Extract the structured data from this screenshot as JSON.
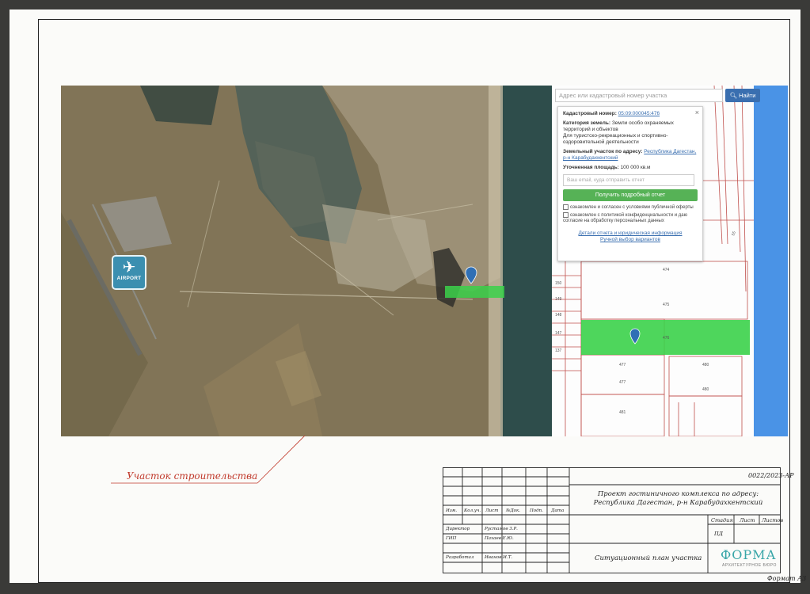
{
  "map": {
    "airport_label": "AIRPORT",
    "search_placeholder": "Адрес или кадастровый номер участка",
    "search_button": "Найти"
  },
  "popup": {
    "cadastral_label": "Кадастровый номер:",
    "cadastral_value": "05:09:000045:476",
    "category_label": "Категория земель:",
    "category_value": "Земли особо охраняемых территорий и объектов",
    "usage_value": "Для туристско-рекреационных и спортивно-оздоровительной деятельности",
    "address_label": "Земельный участок по адресу:",
    "address_value": "Республика Дагестан, р-н Карабудахкентский",
    "area_label": "Уточненная площадь:",
    "area_value": "100 000 кв.м",
    "email_placeholder": "Ваш email, куда отправить отчет",
    "report_button": "Получить подробный отчет",
    "check1": "ознакомлен и согласен с условиями публичной оферты",
    "check2": "ознакомлен с политикой конфиденциальности и даю согласие на обработку персональных данных",
    "link1": "Детали отчета и юридическая информация",
    "link2": "Ручной выбор вариантов"
  },
  "cad_labels": [
    "474",
    "475",
    "150",
    "149",
    "148",
    "147",
    "137",
    "476",
    "477",
    "477",
    "480",
    "480",
    "481",
    "55"
  ],
  "site_label": "Участок строительства",
  "stamp": {
    "code": "0022/2023-АР",
    "project_title": "Проект гостиничного комплекса по адресу: Республика Дагестан, р-н Карабудахкентский",
    "sheet_title": "Ситуационный план участка",
    "hdr": [
      "Изм.",
      "Кол.уч.",
      "Лист",
      "№Док.",
      "Подп.",
      "Дата"
    ],
    "stage_hdr": [
      "Стадия",
      "Лист",
      "Листов"
    ],
    "stage_value": "ПД",
    "roles": [
      {
        "role": "Директор",
        "name": "Рустамов З.Р."
      },
      {
        "role": "ГИП",
        "name": "Пахаев Е.Ю."
      },
      {
        "role": "Разработал",
        "name": "Иванов И.Т."
      }
    ],
    "logo_word": "ФОРМА",
    "logo_sub": "АРХИТЕКТУРНОЕ БЮРО"
  },
  "format_label": "Формат А3"
}
